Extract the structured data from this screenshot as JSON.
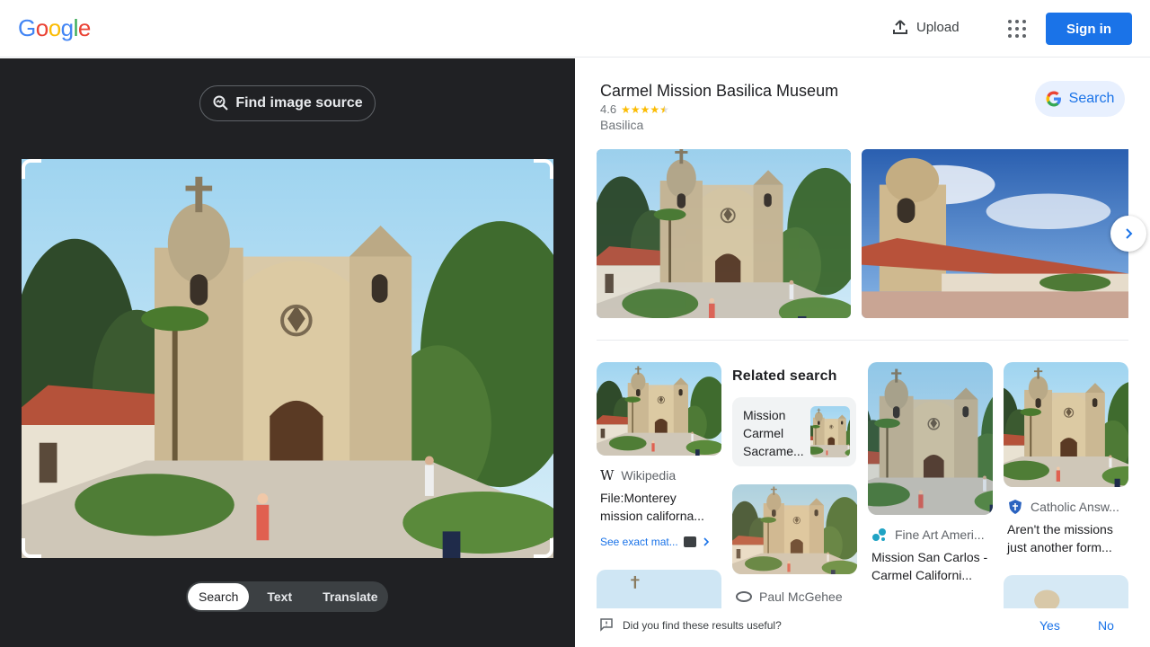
{
  "header": {
    "logo_letters": [
      "G",
      "o",
      "o",
      "g",
      "l",
      "e"
    ],
    "logo_colors": [
      "#4285f4",
      "#ea4335",
      "#fbbc05",
      "#4285f4",
      "#34a853",
      "#ea4335"
    ],
    "upload_label": "Upload",
    "apps_icon": "apps-grid-icon",
    "signin_label": "Sign in"
  },
  "left": {
    "find_source_label": "Find image source",
    "modes": [
      "Search",
      "Text",
      "Translate"
    ],
    "active_mode": "Search"
  },
  "place": {
    "title": "Carmel Mission Basilica Museum",
    "rating": "4.6",
    "stars_shown": 4.5,
    "type": "Basilica",
    "search_label": "Search"
  },
  "results": {
    "related_heading": "Related search",
    "related_text": "Mission Carmel Sacrame...",
    "wikipedia": {
      "source": "Wikipedia",
      "title": "File:Monterey mission californa...",
      "exact_label": "See exact mat..."
    },
    "fineart": {
      "source": "Fine Art Ameri...",
      "title": "Mission San Carlos - Carmel Californi..."
    },
    "catholic": {
      "source": "Catholic Answ...",
      "title": "Aren't the missions just another form..."
    },
    "mcgehee": {
      "source": "Paul McGehee"
    }
  },
  "feedback": {
    "question": "Did you find these results useful?",
    "yes": "Yes",
    "no": "No"
  },
  "colors": {
    "accent": "#1a73e8",
    "dark_bg": "#202124"
  }
}
